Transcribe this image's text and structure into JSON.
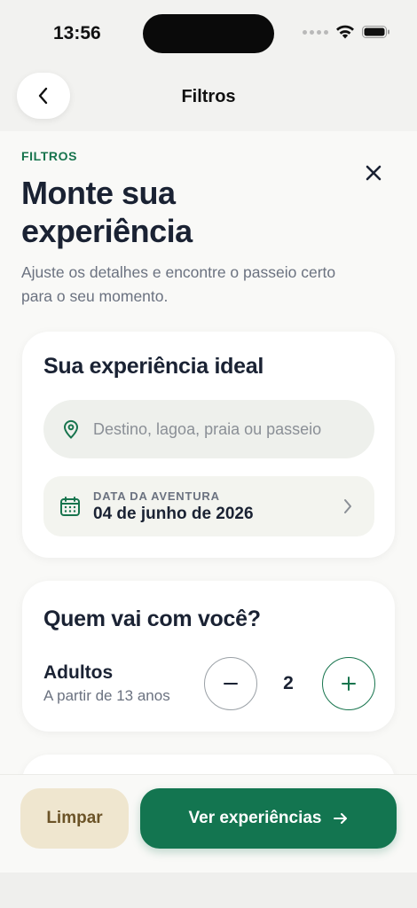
{
  "status_bar": {
    "time": "13:56"
  },
  "nav": {
    "title": "Filtros"
  },
  "header": {
    "eyebrow": "FILTROS",
    "title": "Monte sua experiência",
    "subtitle": "Ajuste os detalhes e encontre o passeio certo para o seu momento."
  },
  "experience_card": {
    "title": "Sua experiência ideal",
    "search_placeholder": "Destino, lagoa, praia ou passeio",
    "search_value": "",
    "date_label": "DATA DA AVENTURA",
    "date_value": "04 de junho de 2026"
  },
  "guests_card": {
    "title": "Quem vai com você?",
    "adults_label": "Adultos",
    "adults_sub": "A partir de 13 anos",
    "adults_count": "2"
  },
  "footer": {
    "clear_label": "Limpar",
    "apply_label": "Ver experiências"
  },
  "colors": {
    "accent": "#137550",
    "clear_bg": "#efe6cf",
    "clear_text": "#6b5327",
    "title": "#1a2233"
  },
  "icons": {
    "back": "chevron-left-icon",
    "close": "close-icon",
    "location": "map-pin-icon",
    "calendar": "calendar-icon",
    "chevron": "chevron-right-icon",
    "minus": "minus-icon",
    "plus": "plus-icon",
    "arrow": "arrow-right-icon"
  }
}
